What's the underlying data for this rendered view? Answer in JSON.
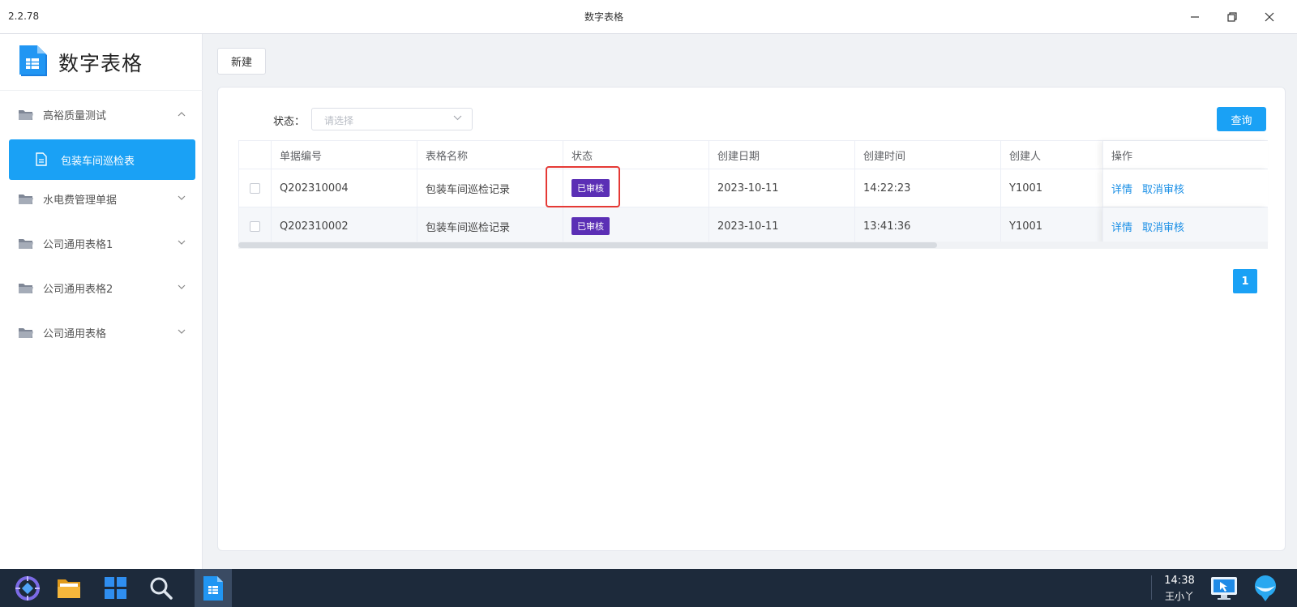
{
  "window": {
    "version": "2.2.78",
    "title": "数字表格"
  },
  "sidebar": {
    "logo_text": "数字表格",
    "items": [
      {
        "label": "高裕质量测试",
        "expanded": true
      },
      {
        "label": "包装车间巡检表",
        "sub": true,
        "active": true
      },
      {
        "label": "水电费管理单据",
        "expanded": false
      },
      {
        "label": "公司通用表格1",
        "expanded": false
      },
      {
        "label": "公司通用表格2",
        "expanded": false
      },
      {
        "label": "公司通用表格",
        "expanded": false
      }
    ]
  },
  "toolbar": {
    "new_label": "新建"
  },
  "filter": {
    "status_label": "状态：",
    "status_placeholder": "请选择",
    "query_label": "查询"
  },
  "table": {
    "columns": [
      "单据编号",
      "表格名称",
      "状态",
      "创建日期",
      "创建时间",
      "创建人",
      "操作"
    ],
    "rows": [
      {
        "id": "Q202310004",
        "name": "包装车间巡检记录",
        "status": "已审核",
        "date": "2023-10-11",
        "time": "14:22:23",
        "creator": "Y1001",
        "actions": [
          "详情",
          "取消审核"
        ]
      },
      {
        "id": "Q202310002",
        "name": "包装车间巡检记录",
        "status": "已审核",
        "date": "2023-10-11",
        "time": "13:41:36",
        "creator": "Y1001",
        "actions": [
          "详情",
          "取消审核"
        ]
      }
    ]
  },
  "pagination": {
    "current_page": "1"
  },
  "taskbar": {
    "time": "14:38",
    "user": "王小丫"
  },
  "colors": {
    "accent": "#1aa1f5",
    "badge": "#5b2fb5",
    "link": "#1a8fe6",
    "highlight": "#e53935",
    "taskbar": "#1d2a3b"
  }
}
